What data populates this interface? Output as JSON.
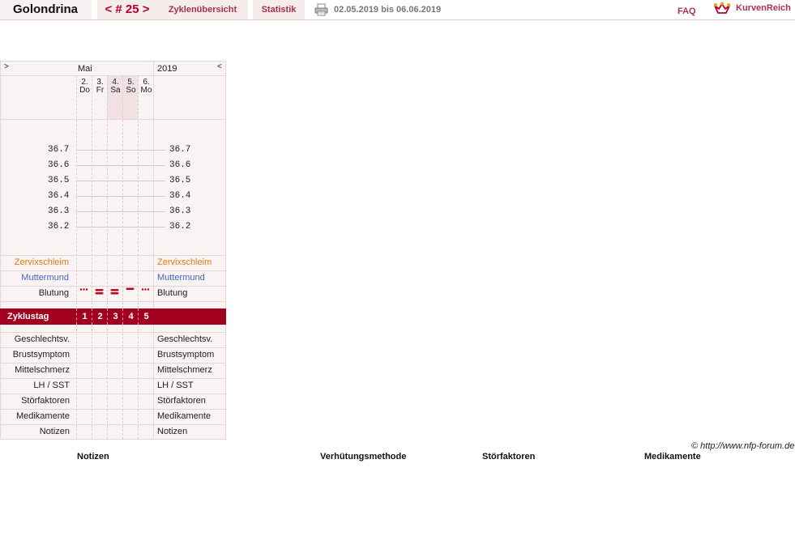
{
  "topbar": {
    "user_name": "Golondrina",
    "cycle_prev": "<",
    "cycle_label": "# 25",
    "cycle_next": ">",
    "overview_label": "Zyklenübersicht",
    "statistics_label": "Statistik",
    "date_range": "02.05.2019 bis 06.06.2019",
    "faq_label": "FAQ",
    "brand_label": "KurvenReich"
  },
  "chart": {
    "nav_left": ">",
    "nav_right": "<",
    "month": "Mai",
    "year": "2019",
    "days": [
      {
        "num": "2.",
        "weekday": "Do",
        "weekend": false
      },
      {
        "num": "3.",
        "weekday": "Fr",
        "weekend": false
      },
      {
        "num": "4.",
        "weekday": "Sa",
        "weekend": true
      },
      {
        "num": "5.",
        "weekday": "So",
        "weekend": true
      },
      {
        "num": "6.",
        "weekday": "Mo",
        "weekend": false
      }
    ],
    "temperatures": [
      "36.7",
      "36.6",
      "36.5",
      "36.4",
      "36.3",
      "36.2"
    ],
    "rows_top": {
      "cervical": "Zervixschleim",
      "cervix": "Muttermund",
      "bleeding": "Blutung"
    },
    "bleeding_levels": [
      "spotting",
      "heavy",
      "heavy",
      "medium",
      "spotting"
    ],
    "cycle_day_label": "Zyklustag",
    "cycle_days": [
      "1",
      "2",
      "3",
      "4",
      "5"
    ],
    "rows_bottom": [
      "Geschlechtsv.",
      "Brustsymptom",
      "Mittelschmerz",
      "LH / SST",
      "Störfaktoren",
      "Medikamente",
      "Notizen"
    ],
    "colors": {
      "accent": "#a3001f",
      "cervical": "#e07a10",
      "cervix": "#4466bb",
      "bleeding": "#c0001a"
    }
  },
  "footer": {
    "copyright": "© http://www.nfp-forum.de",
    "col_notes": "Notizen",
    "col_method": "Verhütungsmethode",
    "col_disturbances": "Störfaktoren",
    "col_medication": "Medikamente"
  }
}
